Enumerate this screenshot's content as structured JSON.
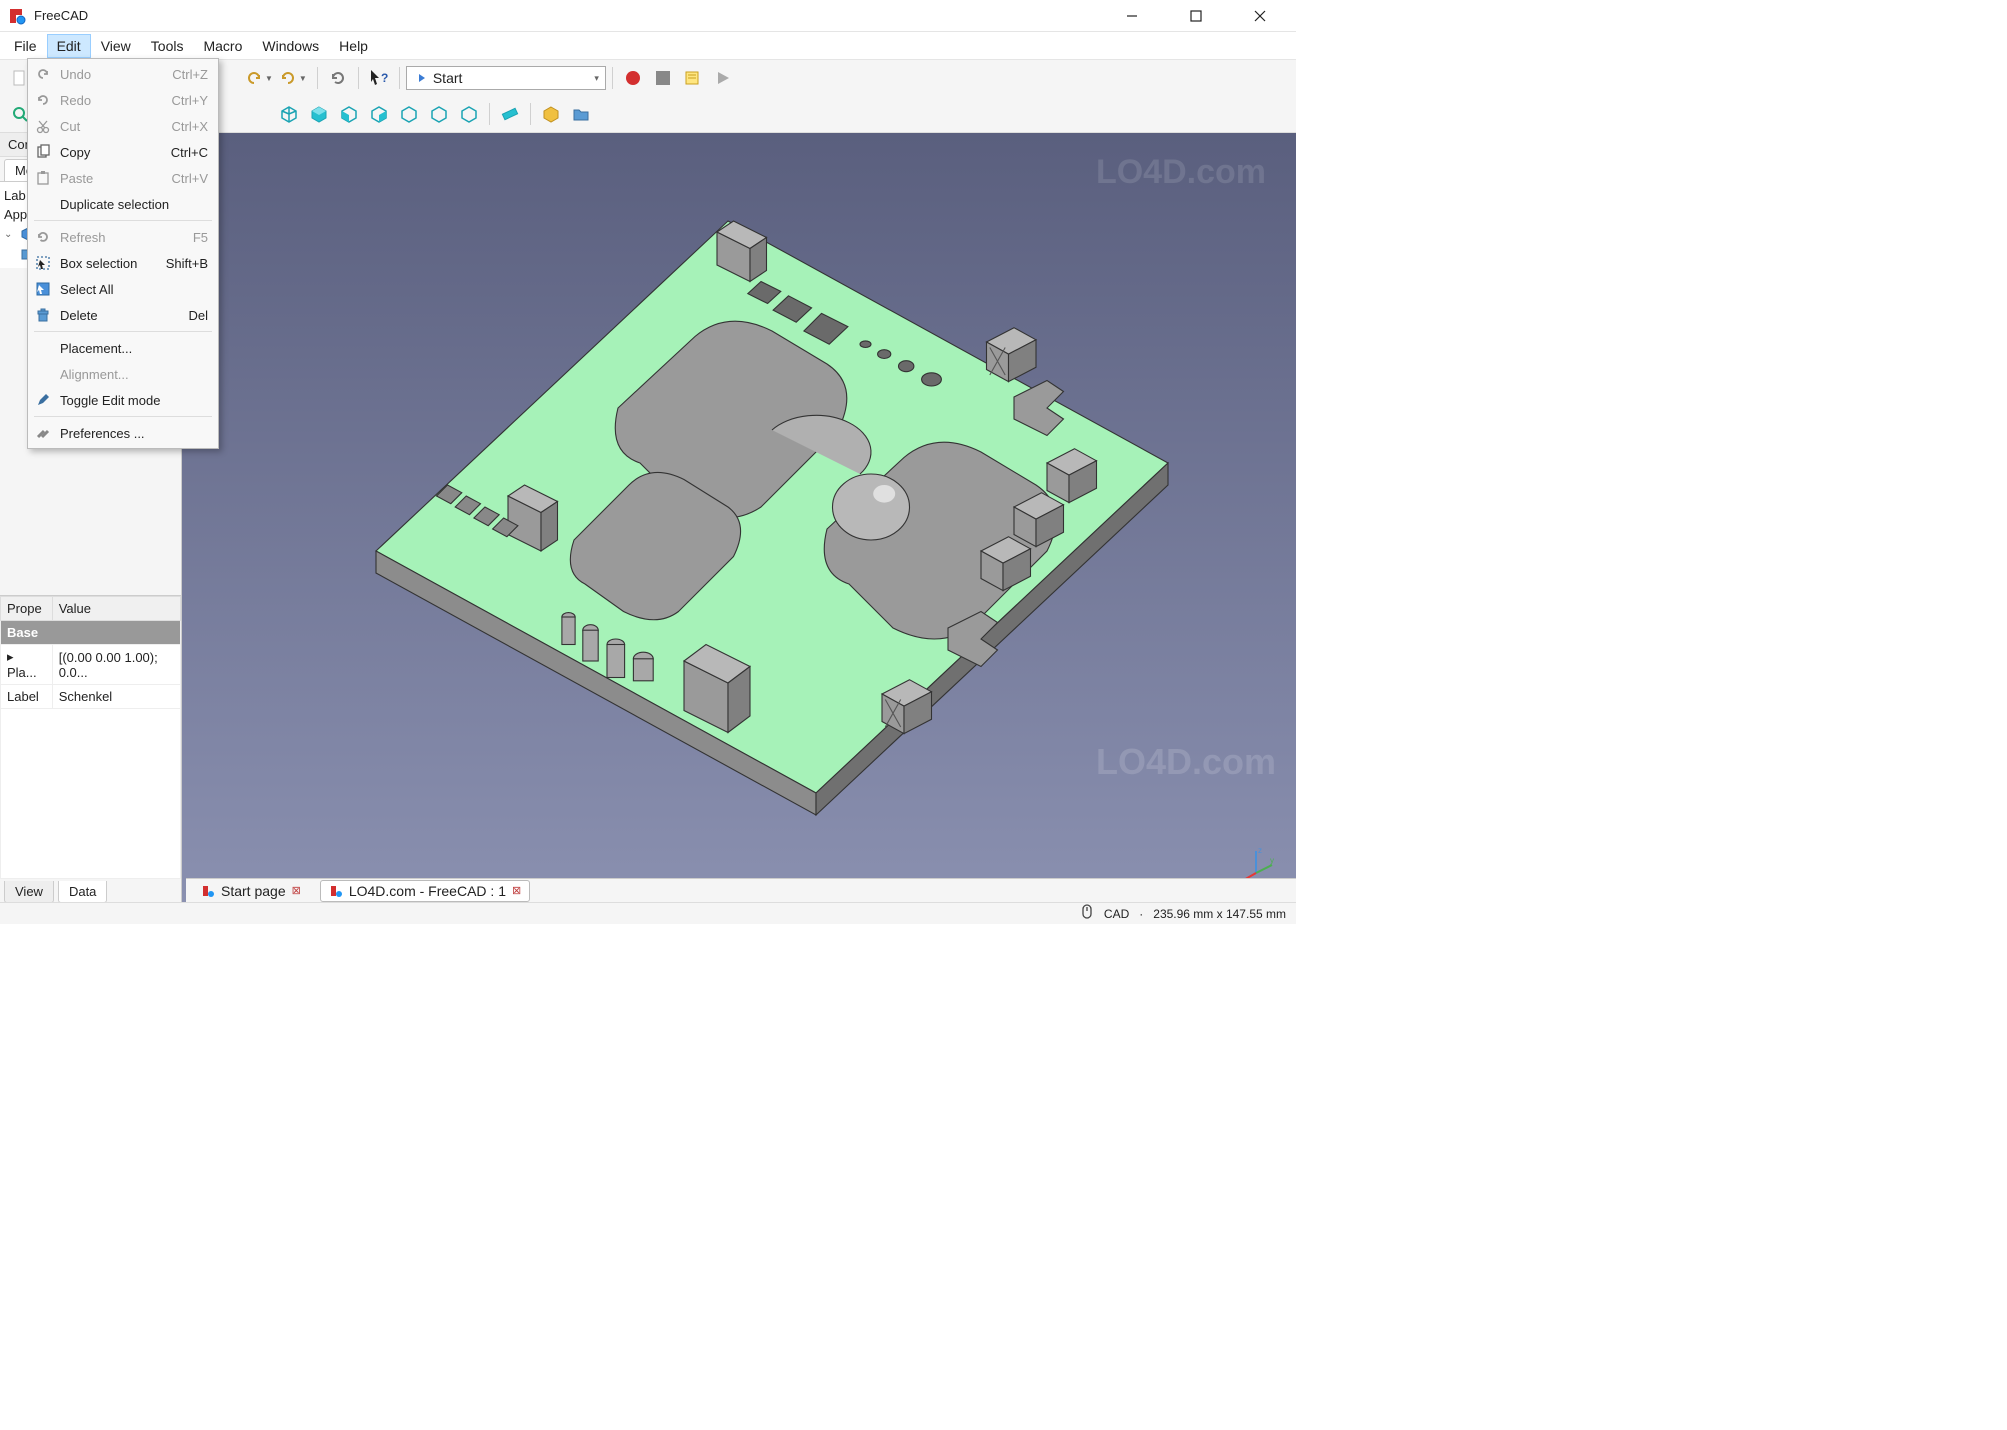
{
  "title": "FreeCAD",
  "menubar": [
    "File",
    "Edit",
    "View",
    "Tools",
    "Macro",
    "Windows",
    "Help"
  ],
  "active_menu_index": 1,
  "edit_menu": [
    {
      "label": "Undo",
      "shortcut": "Ctrl+Z",
      "icon": "undo",
      "disabled": true
    },
    {
      "label": "Redo",
      "shortcut": "Ctrl+Y",
      "icon": "redo",
      "disabled": true
    },
    {
      "label": "Cut",
      "shortcut": "Ctrl+X",
      "icon": "cut",
      "disabled": true
    },
    {
      "label": "Copy",
      "shortcut": "Ctrl+C",
      "icon": "copy",
      "disabled": false
    },
    {
      "label": "Paste",
      "shortcut": "Ctrl+V",
      "icon": "paste",
      "disabled": true
    },
    {
      "label": "Duplicate selection",
      "shortcut": "",
      "icon": "",
      "disabled": false
    },
    {
      "sep": true
    },
    {
      "label": "Refresh",
      "shortcut": "F5",
      "icon": "refresh",
      "disabled": true
    },
    {
      "label": "Box selection",
      "shortcut": "Shift+B",
      "icon": "boxsel",
      "disabled": false
    },
    {
      "label": "Select All",
      "shortcut": "",
      "icon": "selectall",
      "disabled": false
    },
    {
      "label": "Delete",
      "shortcut": "Del",
      "icon": "delete",
      "disabled": false
    },
    {
      "sep": true
    },
    {
      "label": "Placement...",
      "shortcut": "",
      "icon": "",
      "disabled": false
    },
    {
      "label": "Alignment...",
      "shortcut": "",
      "icon": "",
      "disabled": true
    },
    {
      "label": "Toggle Edit mode",
      "shortcut": "",
      "icon": "editmode",
      "disabled": false
    },
    {
      "sep": true
    },
    {
      "label": "Preferences ...",
      "shortcut": "",
      "icon": "prefs",
      "disabled": false
    }
  ],
  "workbench": {
    "label": "Start"
  },
  "left_panel": {
    "header": "Com",
    "tab": "Mo",
    "tree": {
      "rows": [
        "Lab",
        "App"
      ]
    }
  },
  "properties": {
    "headers": [
      "Prope",
      "Value"
    ],
    "group": "Base",
    "rows": [
      {
        "name": "Pla...",
        "value": "[(0.00 0.00 1.00); 0.0..."
      },
      {
        "name": "Label",
        "value": "Schenkel"
      }
    ],
    "tabs": [
      "View",
      "Data"
    ],
    "active_tab": 1
  },
  "doc_tabs": [
    {
      "label": "Start page",
      "closable": true,
      "active": false
    },
    {
      "label": "LO4D.com - FreeCAD : 1",
      "closable": true,
      "active": true
    }
  ],
  "status": {
    "mode": "CAD",
    "coords": "235.96 mm x 147.55 mm"
  },
  "watermark1": "LO4D.com",
  "watermark2": "LO4D.com"
}
